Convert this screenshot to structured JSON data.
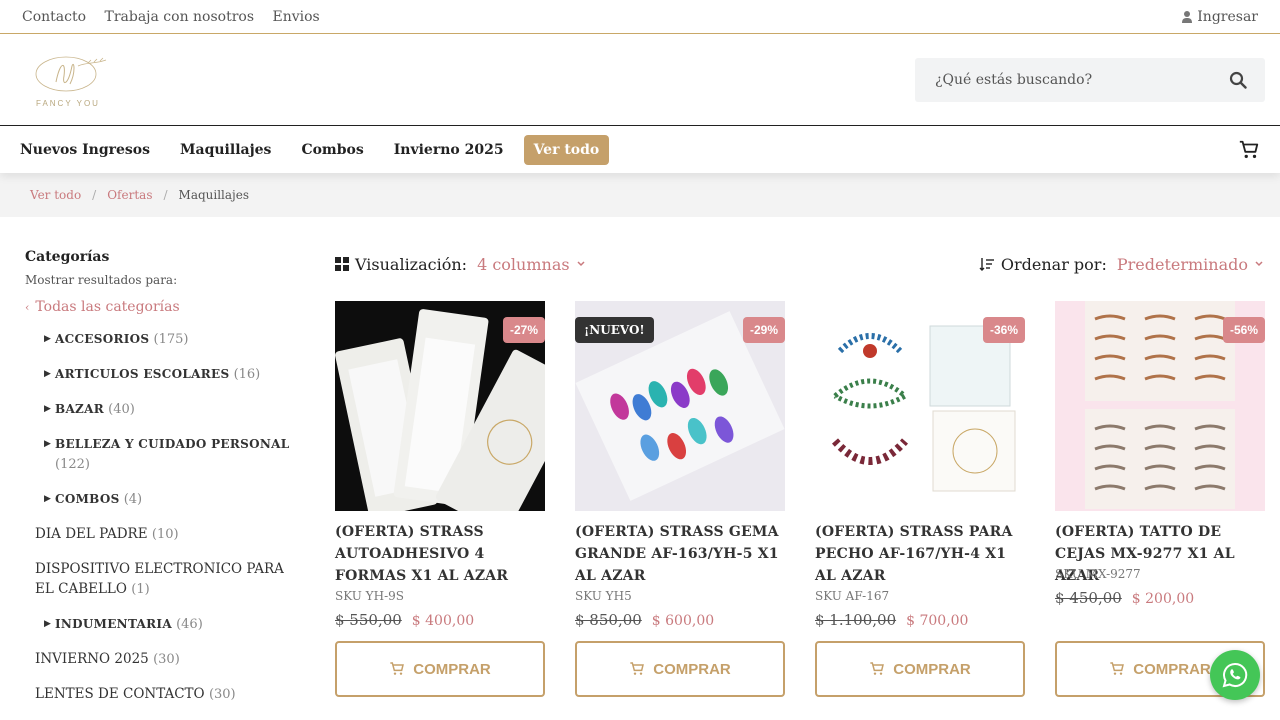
{
  "topbar": {
    "links": [
      "Contacto",
      "Trabaja con nosotros",
      "Envios"
    ],
    "login": "Ingresar"
  },
  "brand": {
    "logo_text": "FANCY YOU"
  },
  "search": {
    "placeholder": "¿Qué estás buscando?"
  },
  "nav": {
    "items": [
      "Nuevos Ingresos",
      "Maquillajes",
      "Combos",
      "Invierno 2025"
    ],
    "cta": "Ver todo"
  },
  "breadcrumb": [
    "Ver todo",
    "Ofertas",
    "Maquillajes"
  ],
  "sidebar": {
    "title": "Categorías",
    "subtitle": "Mostrar resultados para:",
    "all": "Todas las categorías",
    "categories": [
      {
        "name": "ACCESORIOS",
        "count": "(175)"
      },
      {
        "name": "ARTICULOS ESCOLARES",
        "count": "(16)"
      },
      {
        "name": "BAZAR",
        "count": "(40)"
      },
      {
        "name": "BELLEZA Y CUIDADO PERSONAL",
        "count": "(122)"
      },
      {
        "name": "COMBOS",
        "count": "(4)"
      },
      {
        "name": "DIA DEL PADRE",
        "count": "(10)"
      },
      {
        "name": "DISPOSITIVO ELECTRONICO PARA EL CABELLO",
        "count": "(1)"
      },
      {
        "name": "INDUMENTARIA",
        "count": "(46)"
      },
      {
        "name": "INVIERNO 2025",
        "count": "(30)"
      },
      {
        "name": "LENTES DE CONTACTO",
        "count": "(30)"
      }
    ]
  },
  "toolbar": {
    "view_label": "Visualización:",
    "view_value": "4 columnas",
    "sort_label": "Ordenar por:",
    "sort_value": "Predeterminado"
  },
  "products": [
    {
      "title": "(OFERTA) STRASS AUTOADHESIVO 4 FORMAS X1 AL AZAR",
      "sku": "SKU YH-9S",
      "old_price": "$  550,00",
      "price": "$  400,00",
      "discount": "-27%",
      "buy": "COMPRAR"
    },
    {
      "title": "(OFERTA) STRASS GEMA GRANDE AF-163/YH-5 X1 AL AZAR",
      "sku": "SKU YH5",
      "old_price": "$  850,00",
      "price": "$  600,00",
      "discount": "-29%",
      "new_badge": "¡NUEVO!",
      "buy": "COMPRAR"
    },
    {
      "title": "(OFERTA) STRASS PARA PECHO AF-167/YH-4 X1 AL AZAR",
      "sku": "SKU AF-167",
      "old_price": "$  1.100,00",
      "price": "$  700,00",
      "discount": "-36%",
      "buy": "COMPRAR"
    },
    {
      "title": "(OFERTA) TATTO DE CEJAS MX-9277 X1 AL AZAR",
      "sku": "SKU MX-9277",
      "old_price": "$  450,00",
      "price": "$  200,00",
      "discount": "-56%",
      "buy": "COMPRAR"
    }
  ],
  "colors": {
    "accent": "#c5a06a",
    "pink": "#c97a7e",
    "badge": "#d9888b",
    "whatsapp": "#44c657"
  }
}
